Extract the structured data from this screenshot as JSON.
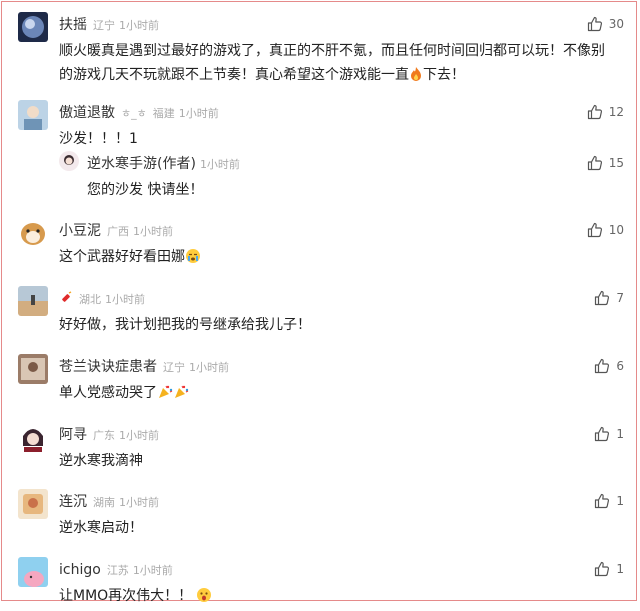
{
  "comments": [
    {
      "name": "扶摇",
      "region": "辽宁",
      "time": "1小时前",
      "likes": "30",
      "text": "顺火暖真是遇到过最好的游戏了，真正的不肝不氪，而且任何时间回归都可以玩！不像别的游戏几天不玩就跟不上节奏！真心希望这个游戏能一直",
      "text_tail": "下去！",
      "emoji": "fire-emoji"
    },
    {
      "name": "傲道退散",
      "name_suffix": "ㅎ_ㅎ",
      "region": "福建",
      "time": "1小时前",
      "likes": "12",
      "text": "沙发！！！1"
    },
    {
      "name": "逆水寒手游(作者)",
      "region": "",
      "time": "1小时前",
      "likes": "15",
      "text": "您的沙发 快请坐！"
    },
    {
      "name": "小豆泥",
      "region": "广西",
      "time": "1小时前",
      "likes": "10",
      "text": "这个武器好好看田娜",
      "emoji": "crying-emoji"
    },
    {
      "name": "",
      "region": "湖北",
      "time": "1小时前",
      "likes": "7",
      "text": "好好做，我计划把我的号继承给我儿子！",
      "name_icon": "firecracker-icon"
    },
    {
      "name": "苍兰诀诀症患者",
      "region": "辽宁",
      "time": "1小时前",
      "likes": "6",
      "text": "单人党感动哭了",
      "emoji": "party-popper-emoji"
    },
    {
      "name": "阿寻",
      "region": "广东",
      "time": "1小时前",
      "likes": "1",
      "text": "逆水寒我滴神"
    },
    {
      "name": "连沉",
      "region": "湖南",
      "time": "1小时前",
      "likes": "1",
      "text": "逆水寒启动！"
    },
    {
      "name": "ichigo",
      "region": "江苏",
      "time": "1小时前",
      "likes": "1",
      "text": "让MMO再次伟大！！",
      "emoji": "surprised-emoji"
    }
  ]
}
